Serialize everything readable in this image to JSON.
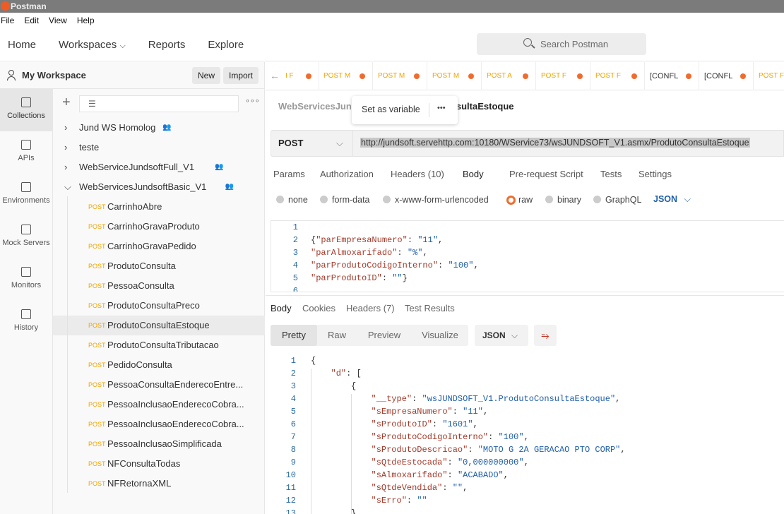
{
  "app": {
    "title": "Postman"
  },
  "menu": [
    "File",
    "Edit",
    "View",
    "Help"
  ],
  "nav": {
    "home": "Home",
    "workspaces": "Workspaces",
    "reports": "Reports",
    "explore": "Explore",
    "search_placeholder": "Search Postman"
  },
  "workspace": {
    "name": "My Workspace",
    "new": "New",
    "import": "Import"
  },
  "rail": [
    {
      "label": "Collections",
      "icon": "collections-icon"
    },
    {
      "label": "APIs",
      "icon": "apis-icon"
    },
    {
      "label": "Environments",
      "icon": "environments-icon"
    },
    {
      "label": "Mock Servers",
      "icon": "mock-servers-icon"
    },
    {
      "label": "Monitors",
      "icon": "monitors-icon"
    },
    {
      "label": "History",
      "icon": "history-icon"
    }
  ],
  "collections": [
    {
      "name": "Jund WS Homolog",
      "shared": true,
      "expanded": false
    },
    {
      "name": "teste",
      "shared": false,
      "expanded": false
    },
    {
      "name": "WebServiceJundsoftFull_V1",
      "shared": true,
      "expanded": false
    },
    {
      "name": "WebServicesJundsoftBasic_V1",
      "shared": true,
      "expanded": true
    }
  ],
  "requests": [
    {
      "method": "POST",
      "name": "CarrinhoAbre"
    },
    {
      "method": "POST",
      "name": "CarrinhoGravaProduto"
    },
    {
      "method": "POST",
      "name": "CarrinhoGravaPedido"
    },
    {
      "method": "POST",
      "name": "ProdutoConsulta"
    },
    {
      "method": "POST",
      "name": "PessoaConsulta"
    },
    {
      "method": "POST",
      "name": "ProdutoConsultaPreco"
    },
    {
      "method": "POST",
      "name": "ProdutoConsultaEstoque",
      "selected": true
    },
    {
      "method": "POST",
      "name": "ProdutoConsultaTributacao"
    },
    {
      "method": "POST",
      "name": "PedidoConsulta"
    },
    {
      "method": "POST",
      "name": "PessoaConsultaEnderecoEntre..."
    },
    {
      "method": "POST",
      "name": "PessoaInclusaoEnderecoCobra..."
    },
    {
      "method": "POST",
      "name": "PessoaInclusaoEnderecoCobra..."
    },
    {
      "method": "POST",
      "name": "PessoaInclusaoSimplificada"
    },
    {
      "method": "POST",
      "name": "NFConsultaTodas"
    },
    {
      "method": "POST",
      "name": "NFRetornaXML"
    }
  ],
  "open_tabs": [
    "I F",
    "POST M",
    "POST M",
    "POST M",
    "POST A",
    "POST F",
    "POST F",
    "[CONFL",
    "[CONFL",
    "POST F"
  ],
  "breadcrumb": {
    "collection": "WebServicesJund",
    "request": "onsultaEstoque"
  },
  "popover": {
    "set_variable": "Set as variable",
    "more": "•••"
  },
  "request": {
    "method": "POST",
    "url": "http://jundsoft.servehttp.com:10180/WService73/wsJUNDSOFT_V1.asmx/ProdutoConsultaEstoque"
  },
  "request_tabs": [
    "Params",
    "Authorization",
    "Headers (10)",
    "Body",
    "Pre-request Script",
    "Tests",
    "Settings"
  ],
  "body_types": [
    "none",
    "form-data",
    "x-www-form-urlencoded",
    "raw",
    "binary",
    "GraphQL"
  ],
  "body_selected": "raw",
  "body_format": "JSON",
  "request_body": [
    [],
    [
      [
        "p",
        "{"
      ],
      [
        "k",
        "\"parEmpresaNumero\""
      ],
      [
        "p",
        ": "
      ],
      [
        "s",
        "\"11\""
      ],
      [
        "p",
        ","
      ]
    ],
    [
      [
        "k",
        "\"parAlmoxarifado\""
      ],
      [
        "p",
        ": "
      ],
      [
        "s",
        "\"%\""
      ],
      [
        "p",
        ","
      ]
    ],
    [
      [
        "k",
        "\"parProdutoCodigoInterno\""
      ],
      [
        "p",
        ": "
      ],
      [
        "s",
        "\"100\""
      ],
      [
        "p",
        ","
      ]
    ],
    [
      [
        "k",
        "\"parProdutoID\""
      ],
      [
        "p",
        ": "
      ],
      [
        "s",
        "\"\""
      ],
      [
        "p",
        "}"
      ]
    ],
    []
  ],
  "response_tabs": [
    "Body",
    "Cookies",
    "Headers (7)",
    "Test Results"
  ],
  "response_views": [
    "Pretty",
    "Raw",
    "Preview",
    "Visualize"
  ],
  "response_format": "JSON",
  "response_body": [
    {
      "i": 0,
      "t": [
        [
          "p",
          "{"
        ]
      ]
    },
    {
      "i": 1,
      "t": [
        [
          "k",
          "\"d\""
        ],
        [
          "p",
          ": ["
        ]
      ]
    },
    {
      "i": 2,
      "t": [
        [
          "p",
          "{"
        ]
      ]
    },
    {
      "i": 3,
      "t": [
        [
          "k",
          "\"__type\""
        ],
        [
          "p",
          ": "
        ],
        [
          "s",
          "\"wsJUNDSOFT_V1.ProdutoConsultaEstoque\""
        ],
        [
          "p",
          ","
        ]
      ]
    },
    {
      "i": 3,
      "t": [
        [
          "k",
          "\"sEmpresaNumero\""
        ],
        [
          "p",
          ": "
        ],
        [
          "s",
          "\"11\""
        ],
        [
          "p",
          ","
        ]
      ]
    },
    {
      "i": 3,
      "t": [
        [
          "k",
          "\"sProdutoID\""
        ],
        [
          "p",
          ": "
        ],
        [
          "s",
          "\"1601\""
        ],
        [
          "p",
          ","
        ]
      ]
    },
    {
      "i": 3,
      "t": [
        [
          "k",
          "\"sProdutoCodigoInterno\""
        ],
        [
          "p",
          ": "
        ],
        [
          "s",
          "\"100\""
        ],
        [
          "p",
          ","
        ]
      ]
    },
    {
      "i": 3,
      "t": [
        [
          "k",
          "\"sProdutoDescricao\""
        ],
        [
          "p",
          ": "
        ],
        [
          "s",
          "\"MOTO G 2A GERACAO PTO CORP\""
        ],
        [
          "p",
          ","
        ]
      ]
    },
    {
      "i": 3,
      "t": [
        [
          "k",
          "\"sQtdeEstocada\""
        ],
        [
          "p",
          ": "
        ],
        [
          "s",
          "\"0,000000000\""
        ],
        [
          "p",
          ","
        ]
      ]
    },
    {
      "i": 3,
      "t": [
        [
          "k",
          "\"sAlmoxarifado\""
        ],
        [
          "p",
          ": "
        ],
        [
          "s",
          "\"ACABADO\""
        ],
        [
          "p",
          ","
        ]
      ]
    },
    {
      "i": 3,
      "t": [
        [
          "k",
          "\"sQtdeVendida\""
        ],
        [
          "p",
          ": "
        ],
        [
          "s",
          "\"\""
        ],
        [
          "p",
          ","
        ]
      ]
    },
    {
      "i": 3,
      "t": [
        [
          "k",
          "\"sErro\""
        ],
        [
          "p",
          ": "
        ],
        [
          "s",
          "\"\""
        ]
      ]
    },
    {
      "i": 2,
      "t": [
        [
          "p",
          "}"
        ]
      ]
    }
  ],
  "colors": {
    "accent": "#ef6c2e",
    "method_post": "#f0a400"
  }
}
